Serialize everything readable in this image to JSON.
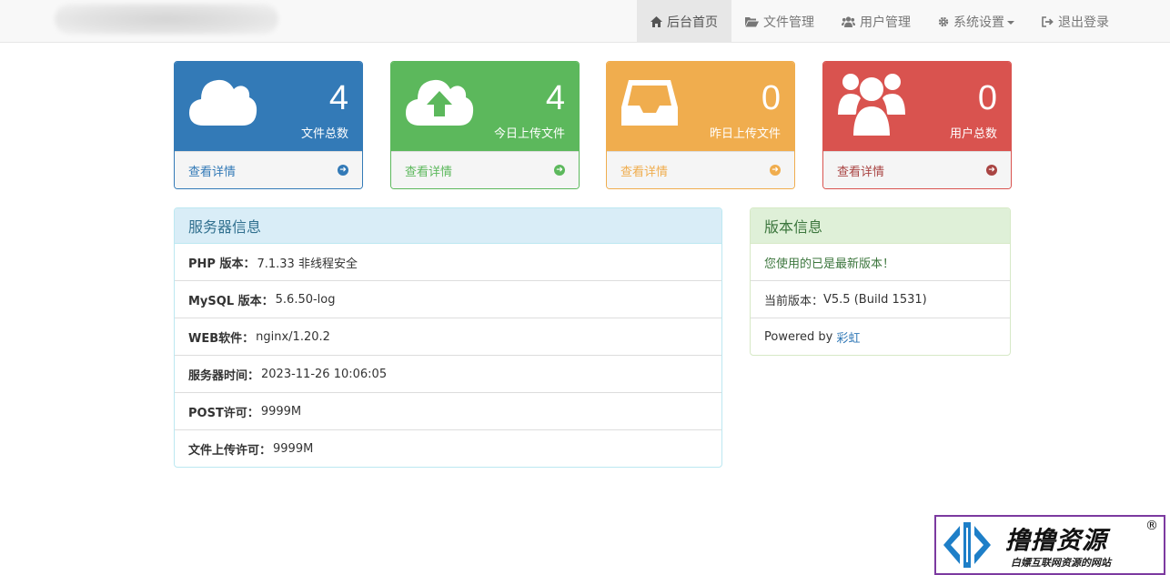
{
  "nav": {
    "items": [
      {
        "label": "后台首页",
        "icon": "home-icon"
      },
      {
        "label": "文件管理",
        "icon": "folder-open-icon"
      },
      {
        "label": "用户管理",
        "icon": "users-icon"
      },
      {
        "label": "系统设置",
        "icon": "gear-icon"
      },
      {
        "label": "退出登录",
        "icon": "sign-out-icon"
      }
    ],
    "active_index": 0
  },
  "stats": [
    {
      "count": "4",
      "label": "文件总数",
      "link": "查看详情",
      "icon": "cloud-icon",
      "color": "#337ab7"
    },
    {
      "count": "4",
      "label": "今日上传文件",
      "link": "查看详情",
      "icon": "cloud-upload-icon",
      "color": "#5cb85c"
    },
    {
      "count": "0",
      "label": "昨日上传文件",
      "link": "查看详情",
      "icon": "inbox-icon",
      "color": "#f0ad4e"
    },
    {
      "count": "0",
      "label": "用户总数",
      "link": "查看详情",
      "icon": "users-icon",
      "color": "#d9534f"
    }
  ],
  "server_panel": {
    "title": "服务器信息",
    "rows": [
      {
        "label": "PHP 版本：",
        "value": "7.1.33 非线程安全"
      },
      {
        "label": "MySQL 版本：",
        "value": "5.6.50-log"
      },
      {
        "label": "WEB软件：",
        "value": "nginx/1.20.2"
      },
      {
        "label": "服务器时间：",
        "value": "2023-11-26 10:06:05"
      },
      {
        "label": "POST许可：",
        "value": "9999M"
      },
      {
        "label": "文件上传许可：",
        "value": "9999M"
      }
    ]
  },
  "version_panel": {
    "title": "版本信息",
    "latest_msg": "您使用的已是最新版本！",
    "current_label": "当前版本：",
    "current_value": "V5.5 (Build 1531)",
    "powered_prefix": "Powered by ",
    "powered_link": "彩虹"
  },
  "watermark": {
    "title": "撸撸资源",
    "reg": "®",
    "subtitle": "白嫖互联网资源的网站"
  }
}
